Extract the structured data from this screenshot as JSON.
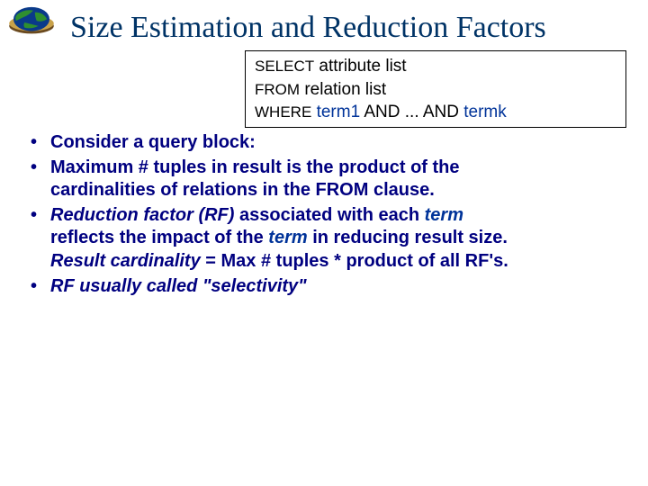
{
  "logo": {
    "name": "earth-logo"
  },
  "title": "Size Estimation and Reduction Factors",
  "query": {
    "kw_select": "SELECT",
    "val_select": "attribute list",
    "kw_from": "FROM",
    "val_from": "relation list",
    "kw_where": "WHERE",
    "term1": "term1",
    "mid": " AND ... AND ",
    "termk": "termk"
  },
  "bullets": {
    "b1": "Consider a query block:",
    "b2_a": "Maximum # tuples in result is the product of the",
    "b2_b": "cardinalities of relations in the FROM clause.",
    "b3_lead": "Reduction factor (RF)",
    "b3_mid": " associated with each ",
    "b3_term": "term",
    "b3_line2_a": "reflects the impact of the ",
    "b3_line2_term": "term",
    "b3_line2_b": " in reducing result size.",
    "b3_line3_a": "Result cardinality",
    "b3_line3_b": " = Max # tuples  *  product of all RF's.",
    "b4": "RF usually called \"selectivity\""
  }
}
